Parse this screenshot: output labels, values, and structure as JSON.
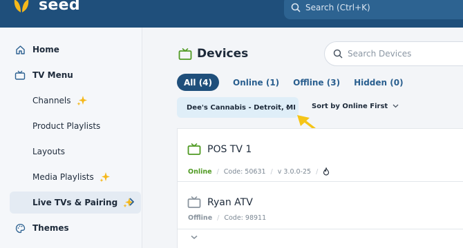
{
  "app": {
    "brand": "seed",
    "search_placeholder": "Search (Ctrl+K)"
  },
  "sidebar": {
    "items": [
      {
        "label": "Home",
        "icon": "home-icon"
      },
      {
        "label": "TV Menu",
        "icon": "tv-icon"
      },
      {
        "label": "Channels",
        "icon": "sparkle-icon"
      },
      {
        "label": "Product Playlists"
      },
      {
        "label": "Layouts"
      },
      {
        "label": "Media Playlists",
        "icon": "sparkle-icon"
      },
      {
        "label": "Live TVs & Pairing",
        "icon": "sparkle-icon",
        "active": true
      },
      {
        "label": "Themes",
        "icon": "palette-icon"
      }
    ]
  },
  "main": {
    "title": "Devices",
    "search_placeholder": "Search Devices",
    "tabs": [
      {
        "label": "All (4)",
        "active": true
      },
      {
        "label": "Online (1)"
      },
      {
        "label": "Offline (3)"
      },
      {
        "label": "Hidden (0)"
      }
    ],
    "location_filter": "Dee's Cannabis - Detroit, MI",
    "sort_label": "Sort by Online First",
    "devices": [
      {
        "name": "POS TV 1",
        "status": "Online",
        "code": "Code: 50631",
        "version": "v 3.0.0-25",
        "status_color": "#4f9a22"
      },
      {
        "name": "Ryan ATV",
        "status": "Offline",
        "code": "Code: 98911",
        "status_color": "#8a949e"
      }
    ]
  },
  "colors": {
    "topbar": "#1f4f7b",
    "accent_yellow": "#f5c518",
    "online_green": "#4f9a22"
  }
}
